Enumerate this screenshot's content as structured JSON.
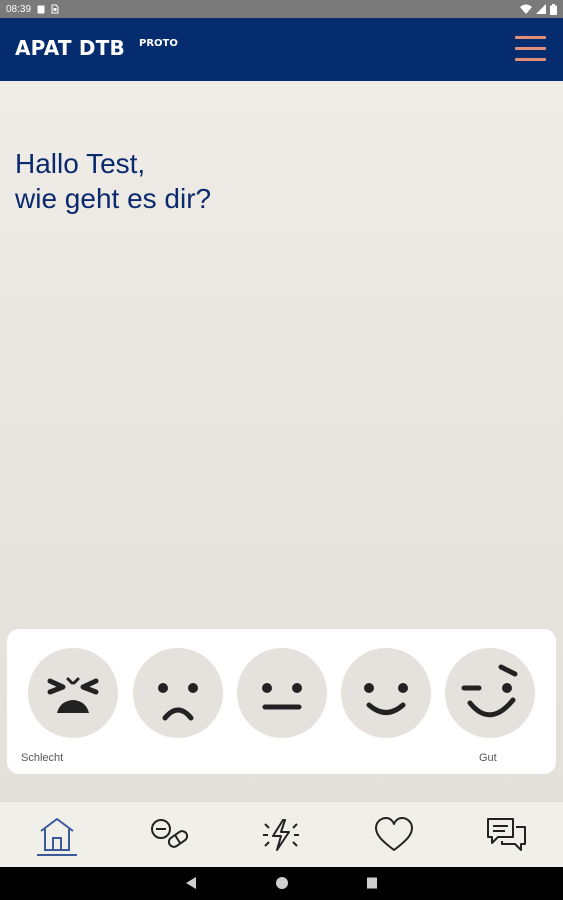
{
  "status_bar": {
    "time": "08:39",
    "icons": [
      "notification-icon",
      "sim-icon",
      "wifi-icon",
      "signal-icon",
      "battery-icon"
    ]
  },
  "app_bar": {
    "title": "APAT DTB",
    "subtitle": "PROTO",
    "menu_icon": "hamburger-menu-icon",
    "background": "#062c70",
    "accent": "#e38f7a"
  },
  "greeting": {
    "line1": "Hallo Test,",
    "line2": "wie geht es dir?"
  },
  "mood_scale": {
    "faces": [
      "very-bad-face-icon",
      "bad-face-icon",
      "neutral-face-icon",
      "good-face-icon",
      "very-good-face-icon"
    ],
    "label_low": "Schlecht",
    "label_high": "Gut"
  },
  "bottom_nav": {
    "items": [
      "home-icon",
      "medication-icon",
      "symptoms-icon",
      "health-icon",
      "chat-icon"
    ],
    "active": "home-icon",
    "active_color": "#3b5a9b"
  },
  "system_nav": {
    "buttons": [
      "back-icon",
      "home-circle-icon",
      "recents-icon"
    ]
  }
}
